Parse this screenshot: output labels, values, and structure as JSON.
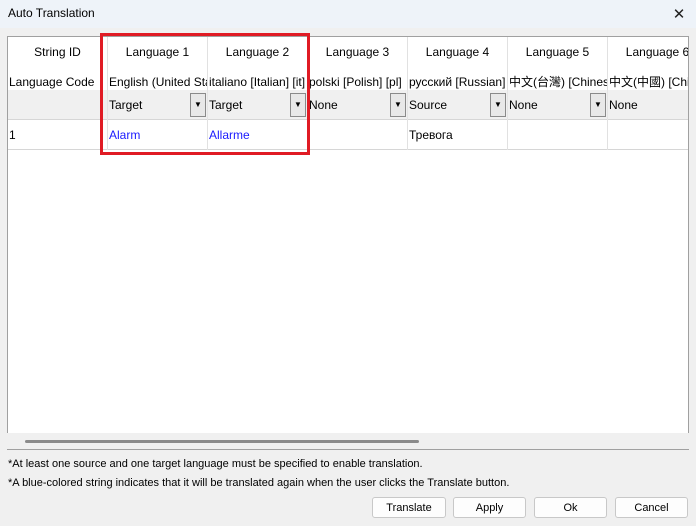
{
  "window": {
    "title": "Auto Translation",
    "close_glyph": "✕"
  },
  "grid": {
    "headers": [
      "String ID",
      "Language 1",
      "Language 2",
      "Language 3",
      "Language 4",
      "Language 5",
      "Language 6"
    ],
    "language_codes": [
      "Language Code",
      "English (United States) [en-US]",
      "italiano [Italian] [it]",
      "polski [Polish] [pl]",
      "русский [Russian] [ru]",
      "中文(台灣) [Chinese (Traditional)]",
      "中文(中國) [Chinese (Simplified)]"
    ],
    "modes": [
      "",
      "Target",
      "Target",
      "None",
      "Source",
      "None",
      "None"
    ],
    "rows": [
      {
        "cells": [
          "1",
          "Alarm",
          "Allarme",
          "",
          "Тревога",
          "",
          ""
        ]
      }
    ],
    "blue_color": "#1a1aff"
  },
  "highlight_color": "#e01b24",
  "notes": [
    "*At least one source and one target language must be specified to enable translation.",
    "*A blue-colored string indicates that it will be translated again when the user clicks the Translate button."
  ],
  "buttons": {
    "translate": "Translate",
    "apply": "Apply",
    "ok": "Ok",
    "cancel": "Cancel"
  }
}
